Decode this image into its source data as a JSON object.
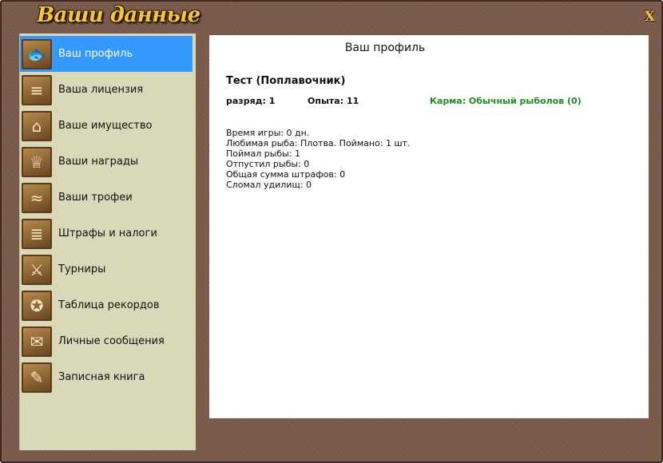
{
  "window": {
    "title": "Ваши данные",
    "close_label": "X"
  },
  "sidebar": {
    "items": [
      {
        "label": "Ваш профиль",
        "icon": "fish-avatar-icon",
        "active": true
      },
      {
        "label": "Ваша лицензия",
        "icon": "license-icon"
      },
      {
        "label": "Ваше имущество",
        "icon": "house-icon"
      },
      {
        "label": "Ваши награды",
        "icon": "trophy-cup-icon"
      },
      {
        "label": "Ваши трофеи",
        "icon": "pike-fish-icon"
      },
      {
        "label": "Штрафы и налоги",
        "icon": "fine-paper-icon"
      },
      {
        "label": "Турниры",
        "icon": "tournament-emblem-icon"
      },
      {
        "label": "Таблица рекордов",
        "icon": "record-medal-icon"
      },
      {
        "label": "Личные сообщения",
        "icon": "envelope-icon"
      },
      {
        "label": "Записная книга",
        "icon": "notebook-icon"
      }
    ]
  },
  "profile": {
    "title": "Ваш профиль",
    "name": "Тест (Поплавочник)",
    "rank": "разряд: 1",
    "experience": "Опыта: 11",
    "karma": "Карма: Обычный рыболов (0)",
    "details": [
      "Время игры: 0 дн.",
      "Любимая рыба: Плотва. Поймано: 1 шт.",
      "Поймал рыбы: 1",
      "Отпустил рыбы: 0",
      "Общая сумма штрафов: 0",
      "Сломал удилищ: 0"
    ]
  },
  "colors": {
    "frame": "#7a5a4a",
    "sidebar_bg": "#d9d8b8",
    "active_item": "#3399ff",
    "title_gold": "#f4c63a",
    "karma_green": "#228b22"
  }
}
